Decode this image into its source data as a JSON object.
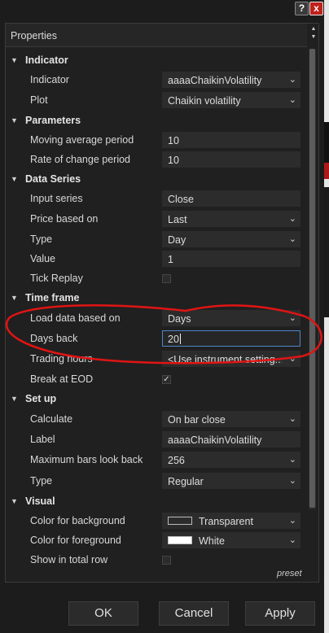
{
  "window": {
    "help_icon": "?",
    "close_icon": "x"
  },
  "panel": {
    "title": "Properties",
    "preset_label": "preset"
  },
  "grid": [
    {
      "type": "category",
      "label": "Indicator"
    },
    {
      "type": "dropdown",
      "label": "Indicator",
      "value": "aaaaChaikinVolatility"
    },
    {
      "type": "dropdown",
      "label": "Plot",
      "value": "Chaikin volatility"
    },
    {
      "type": "category",
      "label": "Parameters"
    },
    {
      "type": "text",
      "label": "Moving average period",
      "value": "10"
    },
    {
      "type": "text",
      "label": "Rate of change period",
      "value": "10"
    },
    {
      "type": "category",
      "label": "Data Series"
    },
    {
      "type": "text",
      "label": "Input series",
      "value": "Close"
    },
    {
      "type": "dropdown",
      "label": "Price based on",
      "value": "Last"
    },
    {
      "type": "dropdown",
      "label": "Type",
      "value": "Day"
    },
    {
      "type": "text",
      "label": "Value",
      "value": "1"
    },
    {
      "type": "checkbox",
      "label": "Tick Replay",
      "checked": false
    },
    {
      "type": "category",
      "label": "Time frame"
    },
    {
      "type": "dropdown",
      "label": "Load data based on",
      "value": "Days"
    },
    {
      "type": "text",
      "label": "Days back",
      "value": "20",
      "focused": true
    },
    {
      "type": "dropdown",
      "label": "Trading hours",
      "value": "<Use instrument setting..."
    },
    {
      "type": "checkbox",
      "label": "Break at EOD",
      "checked": true
    },
    {
      "type": "category",
      "label": "Set up"
    },
    {
      "type": "dropdown",
      "label": "Calculate",
      "value": "On bar close"
    },
    {
      "type": "text",
      "label": "Label",
      "value": "aaaaChaikinVolatility"
    },
    {
      "type": "dropdown",
      "label": "Maximum bars look back",
      "value": "256"
    },
    {
      "type": "dropdown",
      "label": "Type",
      "value": "Regular"
    },
    {
      "type": "category",
      "label": "Visual"
    },
    {
      "type": "color",
      "label": "Color for background",
      "value": "Transparent",
      "swatch": "transparent"
    },
    {
      "type": "color",
      "label": "Color for foreground",
      "value": "White",
      "swatch": "#ffffff"
    },
    {
      "type": "checkbox",
      "label": "Show in total row",
      "checked": false
    }
  ],
  "buttons": {
    "ok": "OK",
    "cancel": "Cancel",
    "apply": "Apply"
  },
  "colors": {
    "accent_focus": "#4f88c8",
    "annotation": "#e11414",
    "close_button": "#c0201a"
  }
}
